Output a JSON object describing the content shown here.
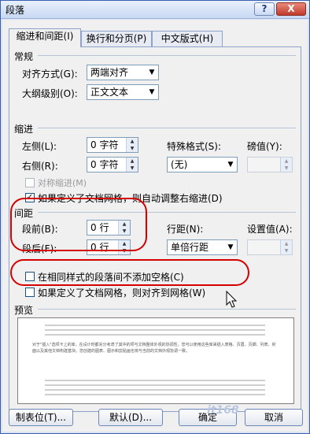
{
  "window": {
    "title": "段落",
    "help_label": "?",
    "close_label": "X"
  },
  "tabs": [
    {
      "label": "缩进和间距(I)"
    },
    {
      "label": "换行和分页(P)"
    },
    {
      "label": "中文版式(H)"
    }
  ],
  "general": {
    "title": "常规",
    "alignment_label": "对齐方式(G):",
    "alignment_value": "两端对齐",
    "outline_label": "大纲级别(O):",
    "outline_value": "正文文本"
  },
  "indent": {
    "title": "缩进",
    "left_label": "左侧(L):",
    "left_value": "0 字符",
    "right_label": "右侧(R):",
    "right_value": "0 字符",
    "special_label": "特殊格式(S):",
    "special_value": "(无)",
    "by_label": "磅值(Y):",
    "by_value": "",
    "mirror_label": "对称缩进(M)",
    "grid_label": "如果定义了文档网格，则自动调整右缩进(D)"
  },
  "spacing": {
    "title": "间距",
    "before_label": "段前(B):",
    "before_value": "0 行",
    "after_label": "段后(F):",
    "after_value": "0 行",
    "line_label": "行距(N):",
    "line_value": "单倍行距",
    "at_label": "设置值(A):",
    "at_value": "",
    "nospace_label": "在相同样式的段落间不添加空格(C)",
    "snap_label": "如果定义了文档网格，则对齐到网格(W)"
  },
  "preview": {
    "title": "预览",
    "sample_text": "对于\"插入\"选项卡上的库，在设计时都充分考虑了其中的项与文档整体外观的协调性。您可以使用这些库来插入表格、页眉、页脚、列表、封面以及其他文档构建基块。您创建的图表、图示和剪贴画也将与当前的文档外观协调一致。"
  },
  "buttons": {
    "tabs": "制表位(T)...",
    "default": "默认(D)...",
    "ok": "确定",
    "cancel": "取消"
  },
  "watermark": "it168",
  "colors": {
    "highlight": "#d40000",
    "accent": "#3b5fb0"
  }
}
